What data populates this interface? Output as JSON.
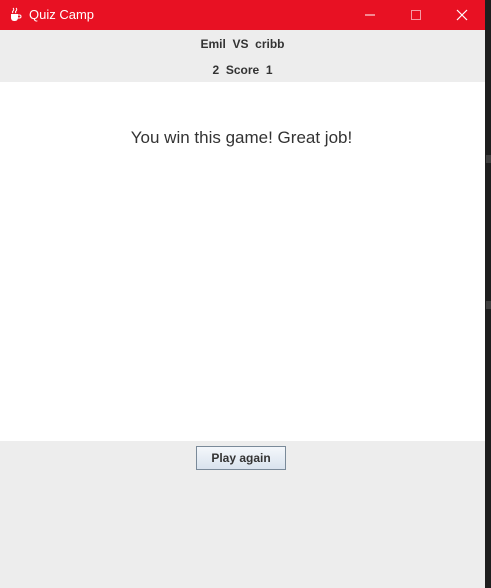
{
  "window": {
    "title": "Quiz Camp",
    "titlebar_color": "#e81123",
    "icons": {
      "app": "java-cup-icon",
      "minimize": "minimize-icon",
      "maximize": "maximize-icon",
      "close": "close-icon"
    }
  },
  "header": {
    "player1": "Emil",
    "vs": "VS",
    "player2": "cribb",
    "score_left": "2",
    "score_label": "Score",
    "score_right": "1"
  },
  "main": {
    "message": "You win this game! Great job!"
  },
  "footer": {
    "play_again_label": "Play again"
  }
}
